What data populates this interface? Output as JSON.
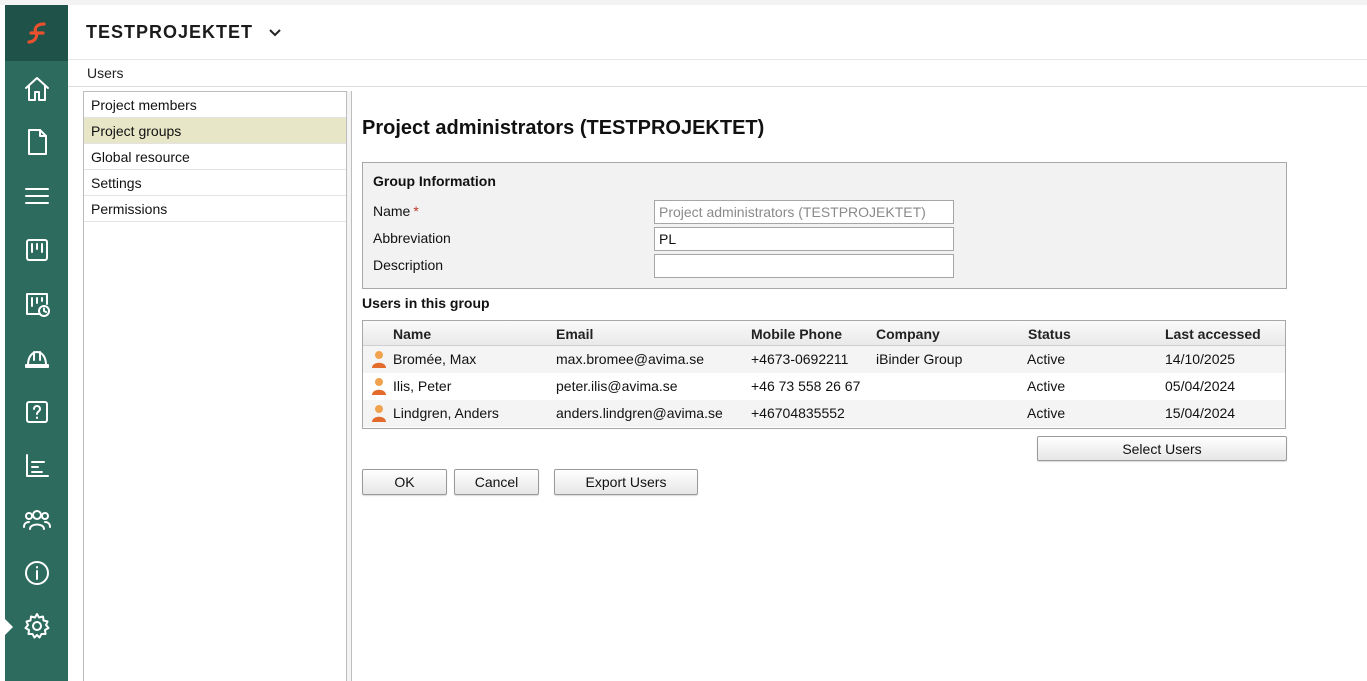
{
  "header": {
    "project_name": "TESTPROJEKTET"
  },
  "breadcrumb": {
    "current": "Users"
  },
  "rail": {
    "icons": [
      "logo-icon",
      "home-icon",
      "document-icon",
      "list-icon",
      "board-icon",
      "board-clock-icon",
      "helmet-icon",
      "help-icon",
      "chart-icon",
      "users-icon",
      "info-icon",
      "gear-icon"
    ],
    "colors": {
      "background": "#2d6b5f",
      "logo_bg": "#1f5248",
      "logo_accent": "#e8502e"
    }
  },
  "menu": {
    "items": [
      {
        "label": "Project members"
      },
      {
        "label": "Project groups"
      },
      {
        "label": "Global resource"
      },
      {
        "label": "Settings"
      },
      {
        "label": "Permissions"
      }
    ],
    "active_index": 1
  },
  "main": {
    "heading": "Project administrators (TESTPROJEKTET)",
    "group_info": {
      "title": "Group Information",
      "name_label": "Name",
      "required_mark": "*",
      "name_value": "Project administrators (TESTPROJEKTET)",
      "abbreviation_label": "Abbreviation",
      "abbreviation_value": "PL",
      "description_label": "Description",
      "description_value": ""
    },
    "users_caption": "Users in this group",
    "table": {
      "columns": [
        "Name",
        "Email",
        "Mobile Phone",
        "Company",
        "Status",
        "Last accessed"
      ],
      "rows": [
        {
          "name": "Bromée, Max",
          "email": "max.bromee@avima.se",
          "phone": "+4673-0692211",
          "company": "iBinder Group",
          "status": "Active",
          "last": "14/10/2025"
        },
        {
          "name": "Ilis, Peter",
          "email": "peter.ilis@avima.se",
          "phone": "+46 73 558 26 67",
          "company": "",
          "status": "Active",
          "last": "05/04/2024"
        },
        {
          "name": "Lindgren, Anders",
          "email": "anders.lindgren@avima.se",
          "phone": "+46704835552",
          "company": "",
          "status": "Active",
          "last": "15/04/2024"
        }
      ]
    },
    "buttons": {
      "select_users": "Select Users",
      "ok": "OK",
      "cancel": "Cancel",
      "export_users": "Export Users"
    }
  }
}
